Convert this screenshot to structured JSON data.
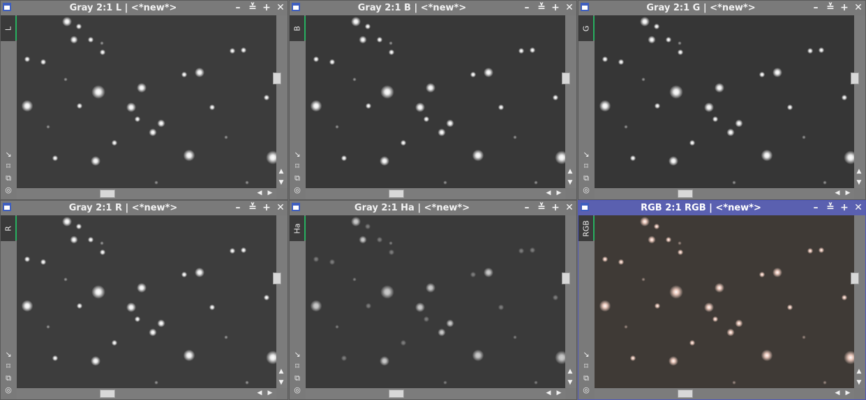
{
  "windows": [
    {
      "title": "Gray 2:1 L | <*new*>",
      "id": "L",
      "active": false,
      "tint": "#ffffff",
      "bg": "#3c3c3c"
    },
    {
      "title": "Gray 2:1 B | <*new*>",
      "id": "B",
      "active": false,
      "tint": "#ffffff",
      "bg": "#383838"
    },
    {
      "title": "Gray 2:1 G | <*new*>",
      "id": "G",
      "active": false,
      "tint": "#ffffff",
      "bg": "#363636"
    },
    {
      "title": "Gray 2:1 R | <*new*>",
      "id": "R",
      "active": false,
      "tint": "#ffffff",
      "bg": "#3d3d3d"
    },
    {
      "title": "Gray 2:1 Ha | <*new*>",
      "id": "Ha",
      "active": false,
      "tint": "#ffffff",
      "bg": "#3a3a3a"
    },
    {
      "title": "RGB 2:1 RGB | <*new*>",
      "id": "RGB",
      "active": true,
      "tint": "#ffd9cc",
      "bg": "#3f3a36"
    }
  ],
  "buttons": {
    "minimize": "–",
    "shade": "≚",
    "maximize": "+",
    "close": "✕"
  },
  "tools": [
    "↘",
    "⌑",
    "⧉",
    "◎"
  ],
  "colors": {
    "active_title": "#5a60b0",
    "inactive_title": "#7a7a7a",
    "id_marker": "#27b060"
  },
  "icons": {
    "system": "window-system-icon",
    "minimize": "minimize-icon",
    "shade": "shade-icon",
    "maximize": "maximize-icon",
    "close": "close-icon"
  }
}
